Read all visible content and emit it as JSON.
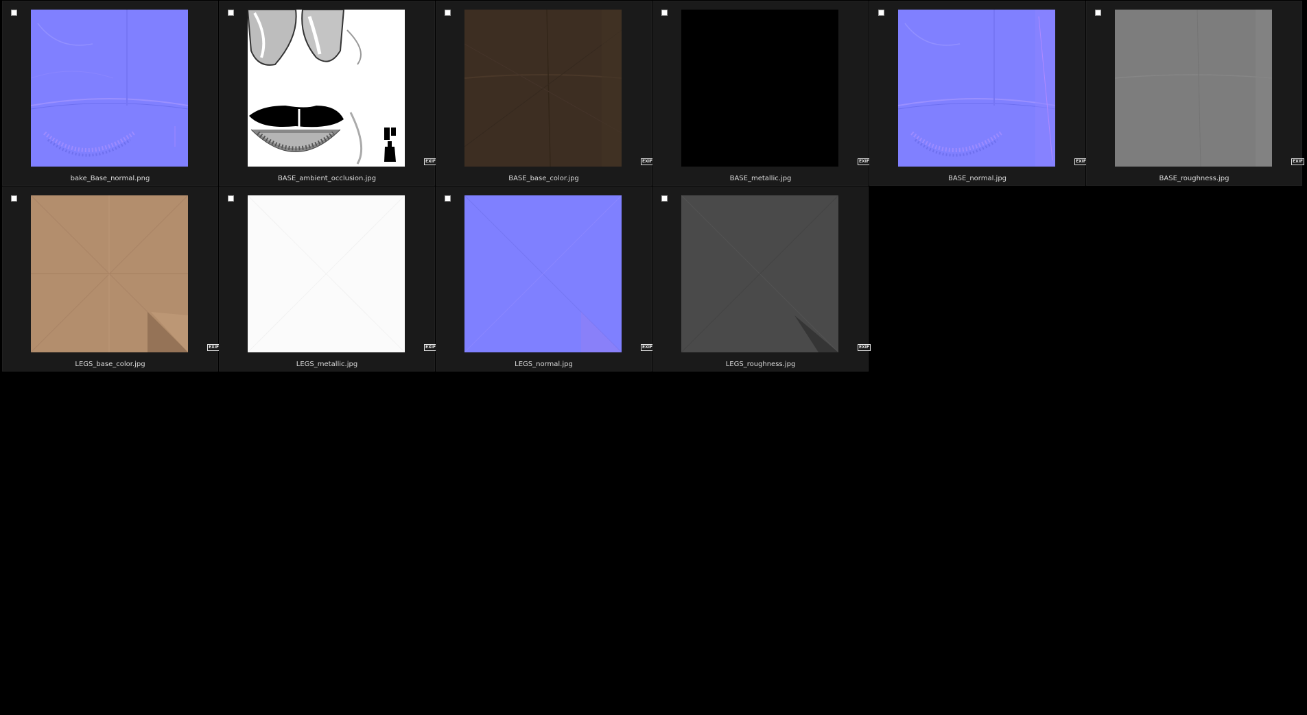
{
  "files": [
    {
      "name": "bake_Base_normal.png",
      "texture": "normal-map",
      "exif": ""
    },
    {
      "name": "BASE_ambient_occlusion.jpg",
      "texture": "ambient-occlusion",
      "exif": "EXIF"
    },
    {
      "name": "BASE_base_color.jpg",
      "texture": "base-color-brown",
      "exif": "EXIF"
    },
    {
      "name": "BASE_metallic.jpg",
      "texture": "black",
      "exif": "EXIF"
    },
    {
      "name": "BASE_normal.jpg",
      "texture": "normal-map",
      "exif": "EXIF"
    },
    {
      "name": "BASE_roughness.jpg",
      "texture": "gray",
      "exif": "EXIF"
    },
    {
      "name": "LEGS_base_color.jpg",
      "texture": "base-color-tan",
      "exif": "EXIF"
    },
    {
      "name": "LEGS_metallic.jpg",
      "texture": "white",
      "exif": "EXIF"
    },
    {
      "name": "LEGS_normal.jpg",
      "texture": "normal-map-flat",
      "exif": "EXIF"
    },
    {
      "name": "LEGS_roughness.jpg",
      "texture": "dark-gray",
      "exif": "EXIF"
    }
  ],
  "colors": {
    "background": "#000000",
    "cell": "#1a1a1a",
    "normal": "#8080ff",
    "brown": "#3d2e22",
    "tan": "#b38e6d",
    "gray": "#7d7d7d",
    "darkgray": "#4a4a4a"
  }
}
